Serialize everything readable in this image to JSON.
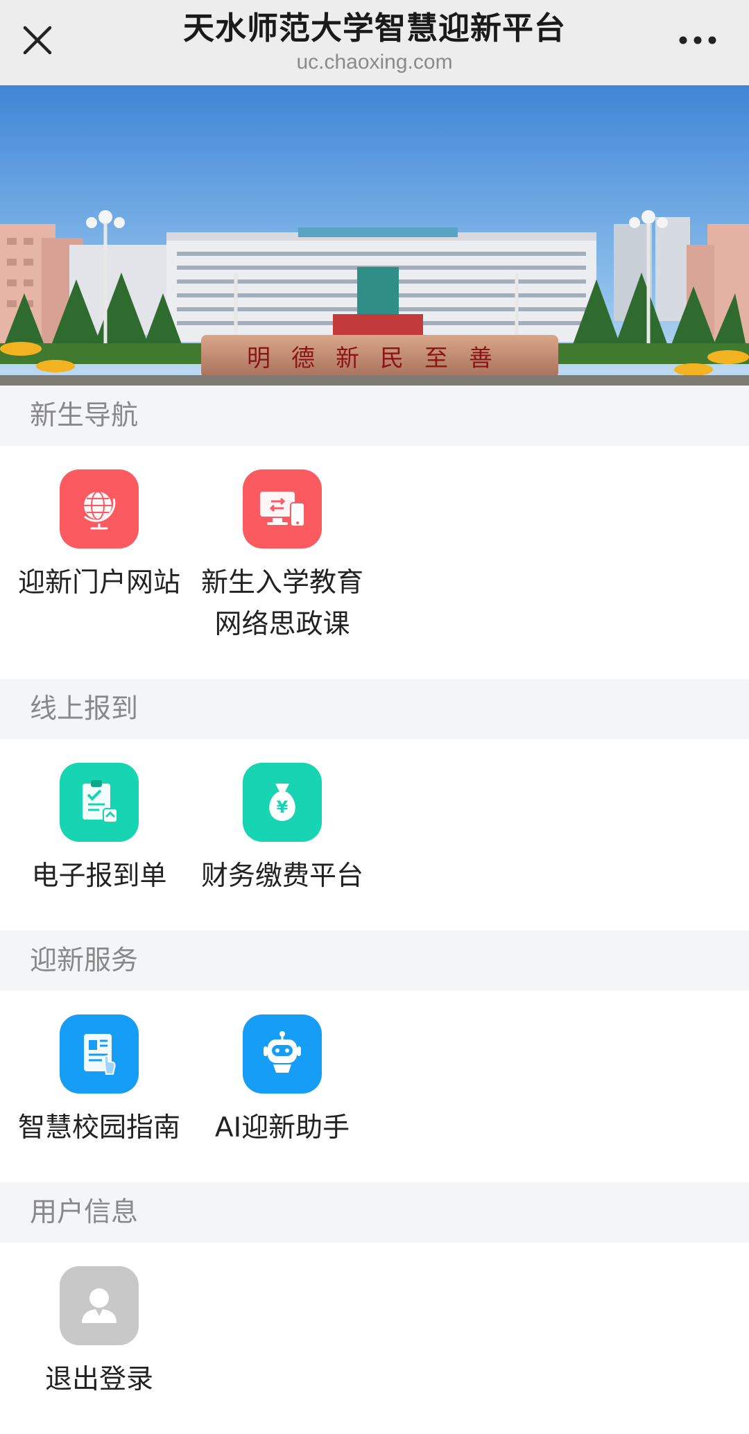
{
  "header": {
    "title": "天水师范大学智慧迎新平台",
    "url": "uc.chaoxing.com",
    "close_icon": "close-icon",
    "more_icon": "more-dots-icon"
  },
  "banner": {
    "inscription": "明德新民至善"
  },
  "sections": [
    {
      "title": "新生导航",
      "items": [
        {
          "label": "迎新门户网站",
          "icon": "globe-icon",
          "color": "#fa5a60"
        },
        {
          "label": "新生入学教育网络思政课",
          "label_line1": "新生入学教育",
          "label_line2": "网络思政课",
          "icon": "monitor-phone-icon",
          "color": "#fa5a60"
        }
      ]
    },
    {
      "title": "线上报到",
      "items": [
        {
          "label": "电子报到单",
          "icon": "clipboard-check-icon",
          "color": "#17d4b2"
        },
        {
          "label": "财务缴费平台",
          "icon": "money-bag-icon",
          "color": "#17d4b2"
        }
      ]
    },
    {
      "title": "迎新服务",
      "items": [
        {
          "label": "智慧校园指南",
          "icon": "guide-document-icon",
          "color": "#169ef7"
        },
        {
          "label": "AI迎新助手",
          "icon": "robot-icon",
          "color": "#169ef7"
        }
      ]
    },
    {
      "title": "用户信息",
      "items": [
        {
          "label": "退出登录",
          "icon": "user-avatar-icon",
          "color": "#c8c8c8"
        }
      ]
    }
  ]
}
